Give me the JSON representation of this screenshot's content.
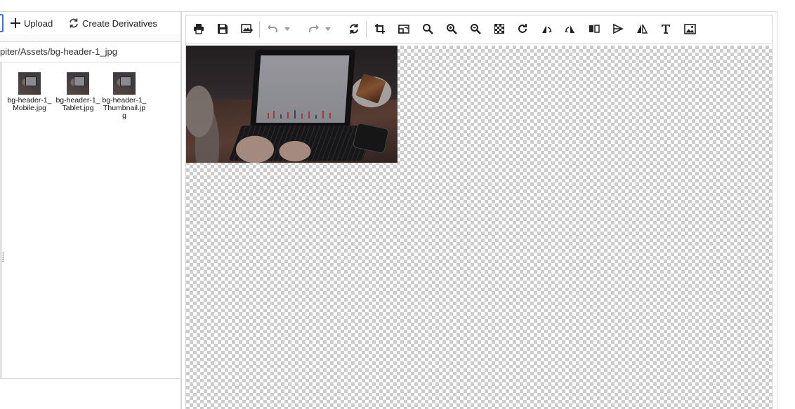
{
  "left_panel": {
    "toolbar": {
      "upload_label": "Upload",
      "create_derivatives_label": "Create Derivatives"
    },
    "path": "piter/Assets/bg-header-1_jpg",
    "files": [
      {
        "name": "bg-header-1_Mobile.jpg"
      },
      {
        "name": "bg-header-1_Tablet.jpg"
      },
      {
        "name": "bg-header-1_Thumbnail.jpg"
      }
    ]
  },
  "editor": {
    "toolbar": {
      "tools": [
        {
          "icon": "print-icon",
          "enabled": true
        },
        {
          "icon": "save-icon",
          "enabled": true
        },
        {
          "icon": "save-as-image-icon",
          "enabled": true
        },
        {
          "icon": "undo-icon",
          "enabled": false
        },
        {
          "icon": "redo-icon",
          "enabled": false
        },
        {
          "icon": "reset-icon",
          "enabled": true
        },
        {
          "icon": "crop-icon",
          "enabled": true
        },
        {
          "icon": "resize-icon",
          "enabled": true
        },
        {
          "icon": "zoom-actual-icon",
          "enabled": true
        },
        {
          "icon": "zoom-in-icon",
          "enabled": true
        },
        {
          "icon": "zoom-out-icon",
          "enabled": true
        },
        {
          "icon": "transparency-icon",
          "enabled": true
        },
        {
          "icon": "rotate-icon",
          "enabled": true
        },
        {
          "icon": "flip-horizontal-icon",
          "enabled": true
        },
        {
          "icon": "flip-vertical-icon",
          "enabled": true
        },
        {
          "icon": "mirror-icon",
          "enabled": true
        },
        {
          "icon": "skew-icon",
          "enabled": true
        },
        {
          "icon": "reflect-icon",
          "enabled": true
        },
        {
          "icon": "text-icon",
          "enabled": true
        },
        {
          "icon": "insert-image-icon",
          "enabled": true
        }
      ]
    },
    "canvas": {
      "background": "transparent-checkerboard",
      "image_name": "bg-header-1.jpg"
    }
  },
  "colors": {
    "accent": "#4a6fc8",
    "border": "#d8d8d8",
    "disabled": "#9a9a9a"
  }
}
